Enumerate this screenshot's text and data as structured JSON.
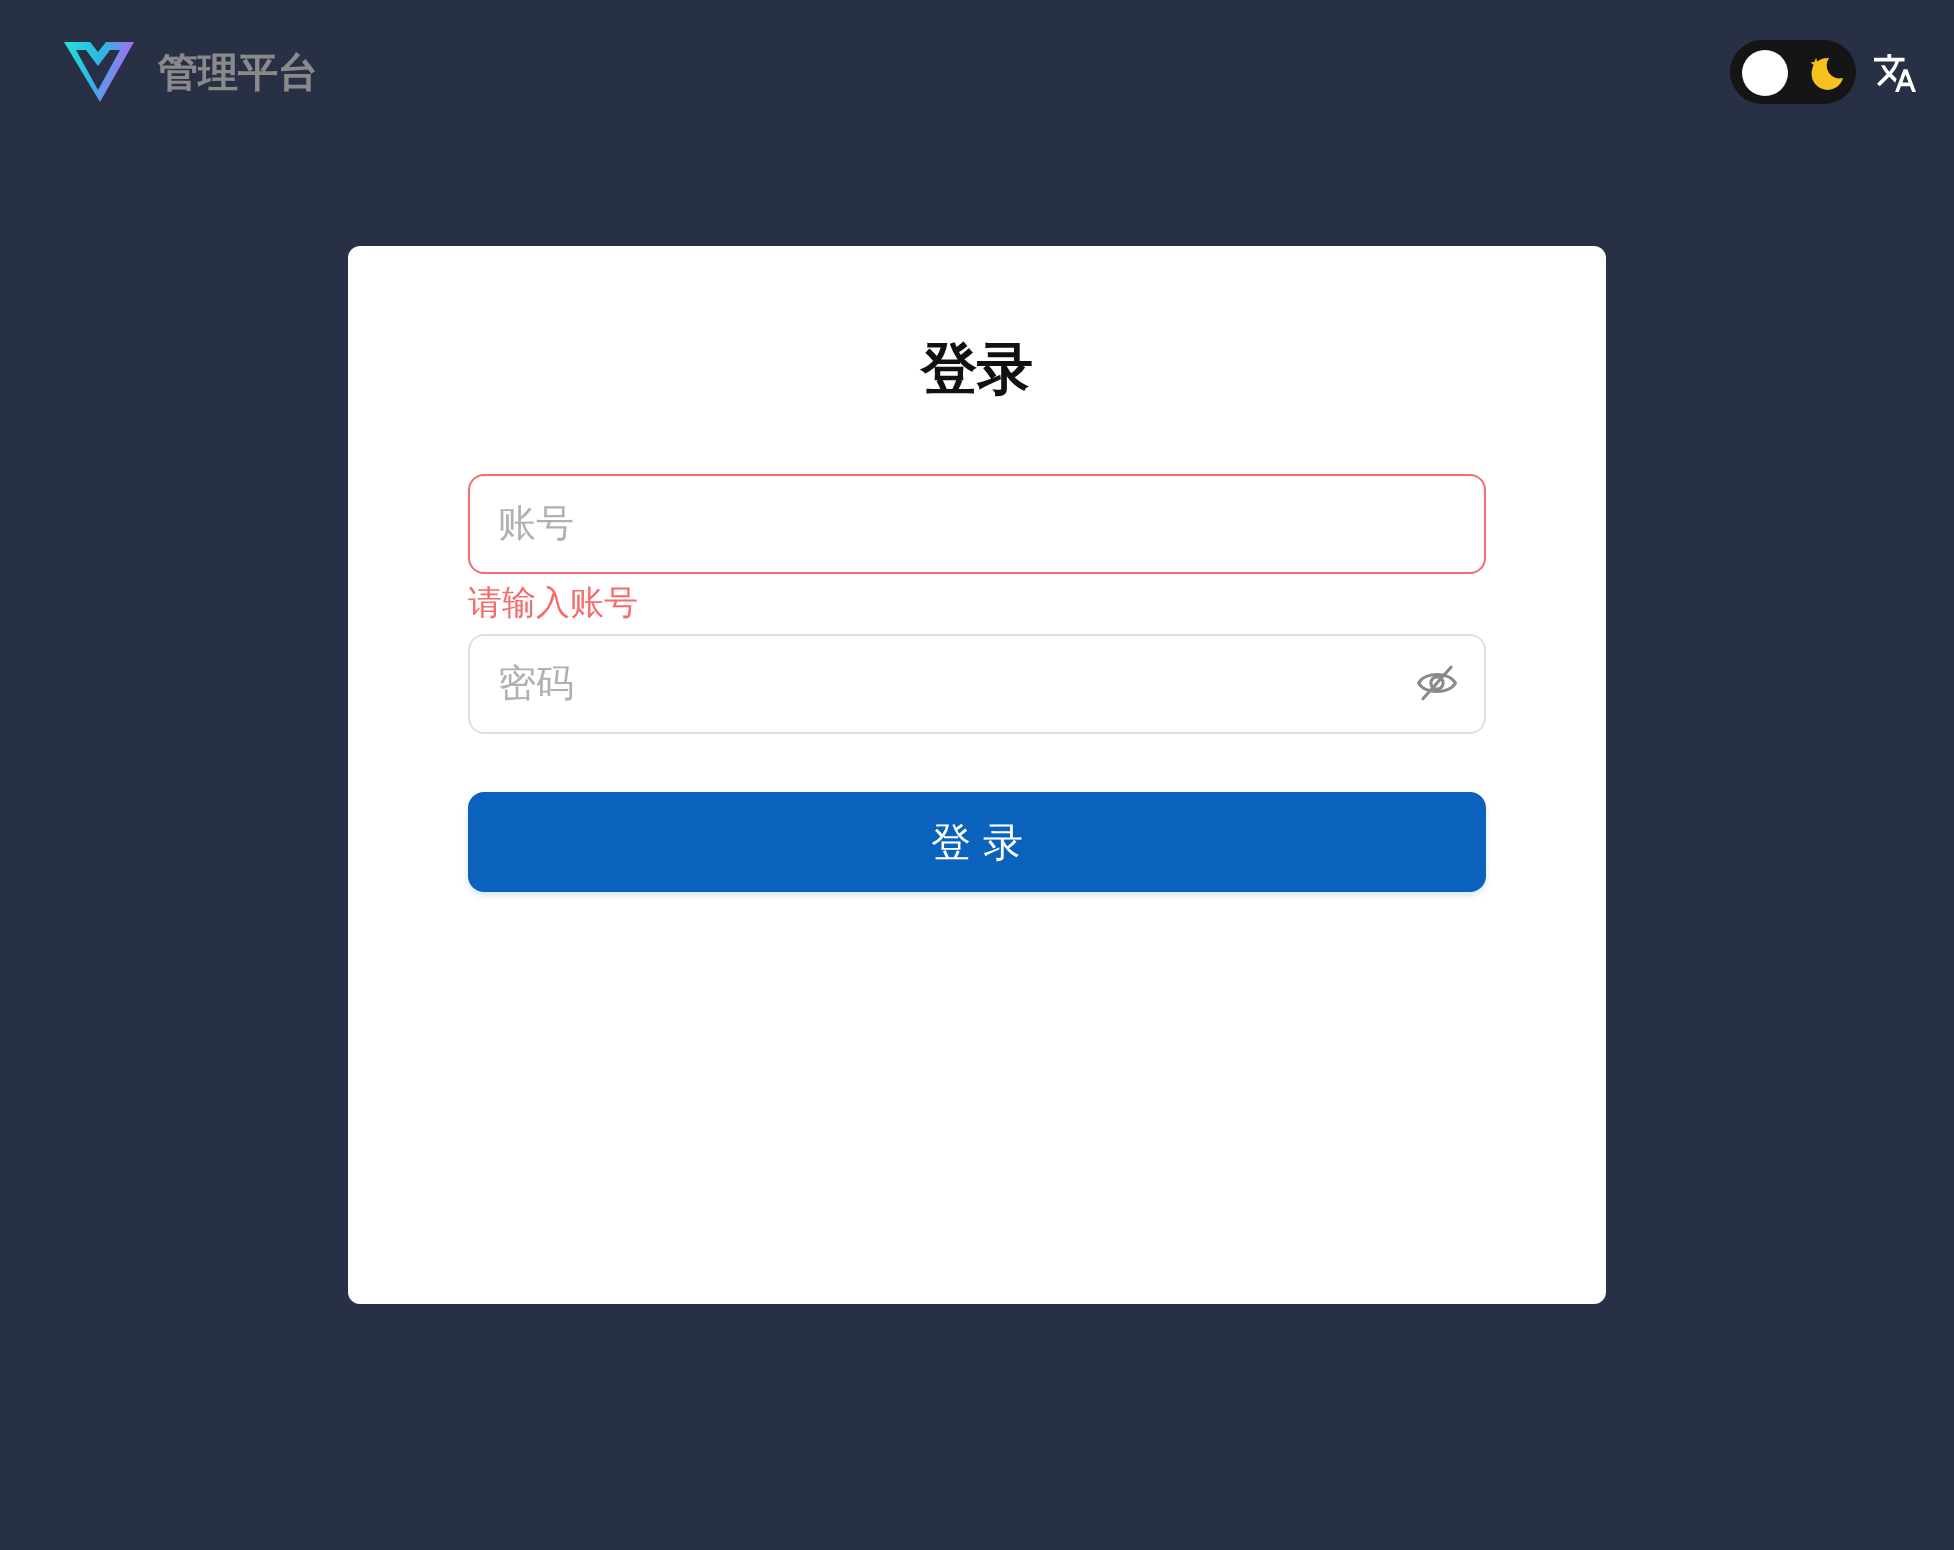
{
  "header": {
    "title": "管理平台",
    "dark_mode": false
  },
  "login_card": {
    "title": "登录",
    "fields": [
      {
        "kind": "text",
        "placeholder": "账号",
        "invalid": true,
        "error": "请输入账号"
      },
      {
        "kind": "password",
        "placeholder": "密码",
        "invalid": false,
        "password_visible": false
      }
    ],
    "submit": "登 录"
  }
}
